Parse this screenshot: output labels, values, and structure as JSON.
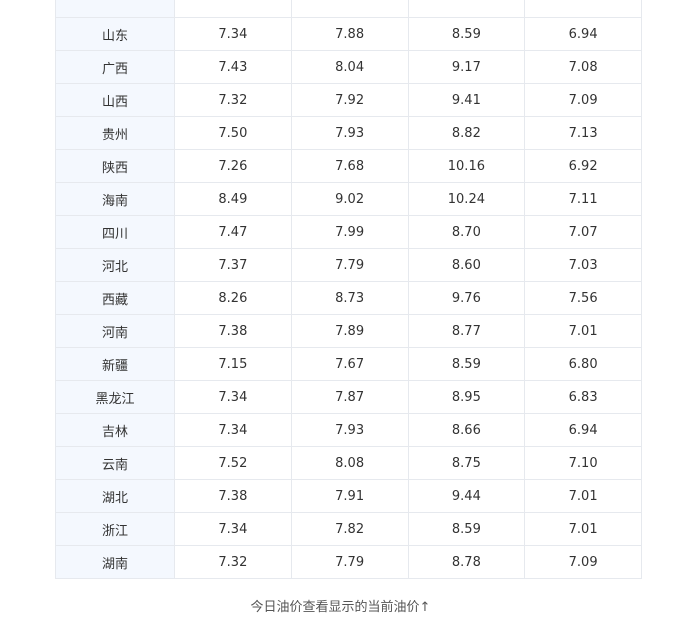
{
  "table": {
    "rows": [
      {
        "province": "",
        "c1": "",
        "c2": "",
        "c3": "",
        "c4": ""
      },
      {
        "province": "山东",
        "c1": "7.34",
        "c2": "7.88",
        "c3": "8.59",
        "c4": "6.94"
      },
      {
        "province": "广西",
        "c1": "7.43",
        "c2": "8.04",
        "c3": "9.17",
        "c4": "7.08"
      },
      {
        "province": "山西",
        "c1": "7.32",
        "c2": "7.92",
        "c3": "9.41",
        "c4": "7.09"
      },
      {
        "province": "贵州",
        "c1": "7.50",
        "c2": "7.93",
        "c3": "8.82",
        "c4": "7.13"
      },
      {
        "province": "陕西",
        "c1": "7.26",
        "c2": "7.68",
        "c3": "10.16",
        "c4": "6.92"
      },
      {
        "province": "海南",
        "c1": "8.49",
        "c2": "9.02",
        "c3": "10.24",
        "c4": "7.11"
      },
      {
        "province": "四川",
        "c1": "7.47",
        "c2": "7.99",
        "c3": "8.70",
        "c4": "7.07"
      },
      {
        "province": "河北",
        "c1": "7.37",
        "c2": "7.79",
        "c3": "8.60",
        "c4": "7.03"
      },
      {
        "province": "西藏",
        "c1": "8.26",
        "c2": "8.73",
        "c3": "9.76",
        "c4": "7.56"
      },
      {
        "province": "河南",
        "c1": "7.38",
        "c2": "7.89",
        "c3": "8.77",
        "c4": "7.01"
      },
      {
        "province": "新疆",
        "c1": "7.15",
        "c2": "7.67",
        "c3": "8.59",
        "c4": "6.80"
      },
      {
        "province": "黑龙江",
        "c1": "7.34",
        "c2": "7.87",
        "c3": "8.95",
        "c4": "6.83"
      },
      {
        "province": "吉林",
        "c1": "7.34",
        "c2": "7.93",
        "c3": "8.66",
        "c4": "6.94"
      },
      {
        "province": "云南",
        "c1": "7.52",
        "c2": "8.08",
        "c3": "8.75",
        "c4": "7.10"
      },
      {
        "province": "湖北",
        "c1": "7.38",
        "c2": "7.91",
        "c3": "9.44",
        "c4": "7.01"
      },
      {
        "province": "浙江",
        "c1": "7.34",
        "c2": "7.82",
        "c3": "8.59",
        "c4": "7.01"
      },
      {
        "province": "湖南",
        "c1": "7.32",
        "c2": "7.79",
        "c3": "8.78",
        "c4": "7.09"
      }
    ]
  },
  "caption": "今日油价查看显示的当前油价↑"
}
